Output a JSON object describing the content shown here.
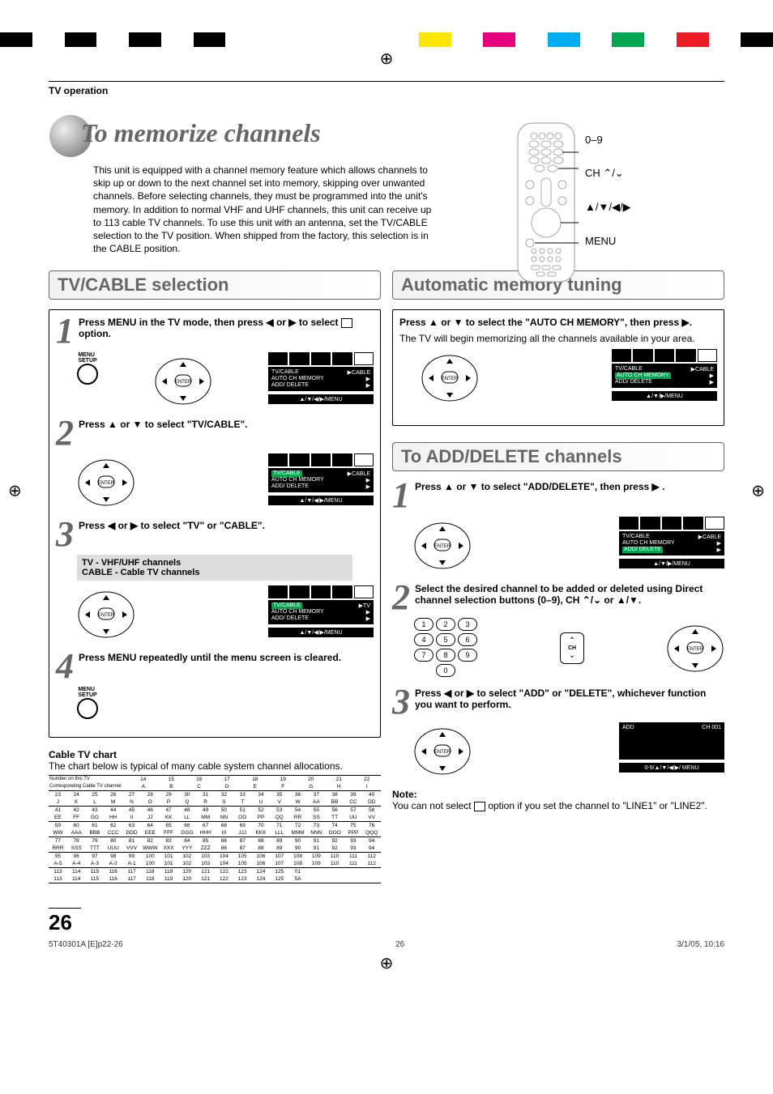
{
  "header": {
    "breadcrumb": "TV operation",
    "title": "To memorize channels",
    "description": "This unit is equipped with a channel memory feature which allows channels to skip up or down to the next channel set into memory, skipping over unwanted channels. Before selecting channels, they must be programmed into the unit's memory. In addition to normal VHF and UHF channels, this unit can receive up to 113 cable TV channels. To use this unit with an antenna, set the TV/CABLE selection to the TV position. When shipped from the factory, this selection is in the CABLE position."
  },
  "remote_labels": {
    "l1": "0–9",
    "l2": "CH ⌃/⌄",
    "l3": "▲/▼/◀/▶",
    "l4": "MENU"
  },
  "tvcable": {
    "title": "TV/CABLE selection",
    "steps": [
      {
        "num": "1",
        "text_a": "Press MENU in the TV mode, then press ◀ or ▶ to select ",
        "text_b": " option."
      },
      {
        "num": "2",
        "text": "Press ▲ or ▼ to select \"TV/CABLE\"."
      },
      {
        "num": "3",
        "text": "Press ◀ or ▶ to select \"TV\" or \"CABLE\"."
      },
      {
        "num": "4",
        "text": "Press MENU repeatedly until the menu screen is cleared."
      }
    ],
    "box": {
      "line1": "TV - VHF/UHF channels",
      "line2": "CABLE - Cable TV channels"
    },
    "osd": {
      "line1": "TV/CABLE",
      "line1v": "▶CABLE",
      "line2": "AUTO CH MEMORY",
      "line2v": "▶",
      "line3": "ADD/ DELETE",
      "line3v": "▶",
      "foot": "▲/▼/◀/▶/MENU",
      "line1tv": "▶TV"
    }
  },
  "auto_memory": {
    "title": "Automatic memory tuning",
    "step1": "Press ▲ or ▼ to select the \"AUTO CH MEMORY\", then press ▶.",
    "desc": "The TV will begin memorizing all the channels available in your area.",
    "osd_foot": "▲/▼/▶/MENU"
  },
  "add_delete": {
    "title": "To ADD/DELETE channels",
    "step1": "Press ▲ or ▼ to select \"ADD/DELETE\", then press ▶ .",
    "step2": "Select the desired channel to be added or deleted using Direct channel selection buttons (0–9), CH ⌃/⌄ or ▲/▼.",
    "step3": "Press ◀ or ▶ to select \"ADD\" or \"DELETE\", whichever function you want to perform.",
    "osd2": {
      "l": "ADD",
      "r": "CH 001",
      "foot": "0-9/▲/▼/◀/▶/ MENU"
    },
    "ch_label": "CH"
  },
  "chart": {
    "title": "Cable TV chart",
    "desc": "The chart below is typical of many cable system channel allocations.",
    "label1": "Number on this TV",
    "label2": "Corresponding Cable TV channel",
    "rows": [
      {
        "a": [
          "",
          "",
          "",
          "",
          "",
          "",
          "",
          "",
          "",
          "14",
          "15",
          "16",
          "17",
          "18",
          "19",
          "20",
          "21",
          "22"
        ],
        "b": [
          "",
          "",
          "",
          "",
          "",
          "",
          "",
          "",
          "",
          "A",
          "B",
          "C",
          "D",
          "E",
          "F",
          "G",
          "H",
          "I"
        ]
      },
      {
        "a": [
          "23",
          "24",
          "25",
          "26",
          "27",
          "28",
          "29",
          "30",
          "31",
          "32",
          "33",
          "34",
          "35",
          "36",
          "37",
          "38",
          "39",
          "40"
        ],
        "b": [
          "J",
          "K",
          "L",
          "M",
          "N",
          "O",
          "P",
          "Q",
          "R",
          "S",
          "T",
          "U",
          "V",
          "W",
          "AA",
          "BB",
          "CC",
          "DD"
        ]
      },
      {
        "a": [
          "41",
          "42",
          "43",
          "44",
          "45",
          "46",
          "47",
          "48",
          "49",
          "50",
          "51",
          "52",
          "53",
          "54",
          "55",
          "56",
          "57",
          "58"
        ],
        "b": [
          "EE",
          "FF",
          "GG",
          "HH",
          "II",
          "JJ",
          "KK",
          "LL",
          "MM",
          "NN",
          "OO",
          "PP",
          "QQ",
          "RR",
          "SS",
          "TT",
          "UU",
          "VV"
        ]
      },
      {
        "a": [
          "59",
          "60",
          "61",
          "62",
          "63",
          "64",
          "65",
          "66",
          "67",
          "68",
          "69",
          "70",
          "71",
          "72",
          "73",
          "74",
          "75",
          "76"
        ],
        "b": [
          "WW",
          "AAA",
          "BBB",
          "CCC",
          "DDD",
          "EEE",
          "FFF",
          "GGG",
          "HHH",
          "III",
          "JJJ",
          "KKK",
          "LLL",
          "MMM",
          "NNN",
          "OOO",
          "PPP",
          "QQQ"
        ]
      },
      {
        "a": [
          "77",
          "78",
          "79",
          "80",
          "81",
          "82",
          "83",
          "84",
          "85",
          "86",
          "87",
          "88",
          "89",
          "90",
          "91",
          "92",
          "93",
          "94"
        ],
        "b": [
          "RRR",
          "SSS",
          "TTT",
          "UUU",
          "VVV",
          "WWW",
          "XXX",
          "YYY",
          "ZZZ",
          "86",
          "87",
          "88",
          "89",
          "90",
          "91",
          "92",
          "93",
          "94"
        ]
      },
      {
        "a": [
          "95",
          "96",
          "97",
          "98",
          "99",
          "100",
          "101",
          "102",
          "103",
          "104",
          "105",
          "106",
          "107",
          "108",
          "109",
          "110",
          "111",
          "112"
        ],
        "b": [
          "A-5",
          "A-4",
          "A-3",
          "A-2",
          "A-1",
          "100",
          "101",
          "102",
          "103",
          "104",
          "105",
          "106",
          "107",
          "108",
          "109",
          "110",
          "111",
          "112"
        ]
      },
      {
        "a": [
          "113",
          "114",
          "115",
          "116",
          "117",
          "118",
          "119",
          "120",
          "121",
          "122",
          "123",
          "124",
          "125",
          "01",
          "",
          "",
          "",
          ""
        ],
        "b": [
          "113",
          "114",
          "115",
          "116",
          "117",
          "118",
          "119",
          "120",
          "121",
          "122",
          "123",
          "124",
          "125",
          "5A",
          "",
          "",
          "",
          ""
        ]
      }
    ]
  },
  "note": {
    "title": "Note:",
    "body_a": "You can not select ",
    "body_b": " option if you set the channel to \"LINE1\" or \"LINE2\"."
  },
  "page_num": "26",
  "footer": {
    "left": "5T40301A [E]p22-26",
    "center": "26",
    "right": "3/1/05, 10:16"
  },
  "menu_setup_label": "MENU\nSETUP"
}
